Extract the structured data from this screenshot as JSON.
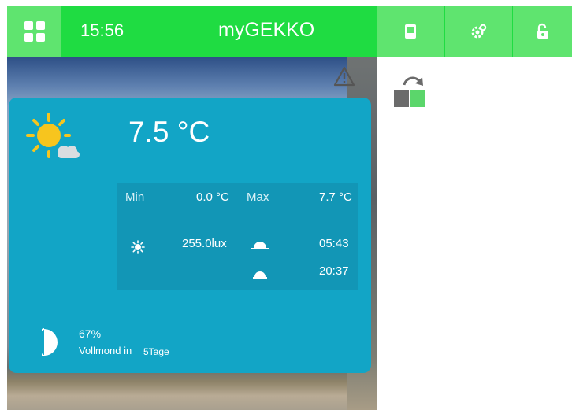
{
  "topbar": {
    "time": "15:56",
    "brand": "myGEKKO",
    "menu_icon": "grid-icon",
    "buttons": [
      {
        "icon": "panel-icon"
      },
      {
        "icon": "settings-cog-icon"
      },
      {
        "icon": "unlock-icon"
      }
    ]
  },
  "weather": {
    "condition_icon": "sun-cloud-icon",
    "temperature": "7.5 °C",
    "min_label": "Min",
    "min_value": "0.0 °C",
    "max_label": "Max",
    "max_value": "7.7 °C",
    "lux": "255.0lux",
    "sunrise": "05:43",
    "sunset": "20:37"
  },
  "moon": {
    "percent": "67%",
    "label": "Vollmond in",
    "days": "5Tage"
  },
  "colors": {
    "accent_green": "#1fdc42",
    "button_green": "#5fe46f",
    "card_blue": "#12a5c6",
    "stats_blue": "#1296b6"
  }
}
